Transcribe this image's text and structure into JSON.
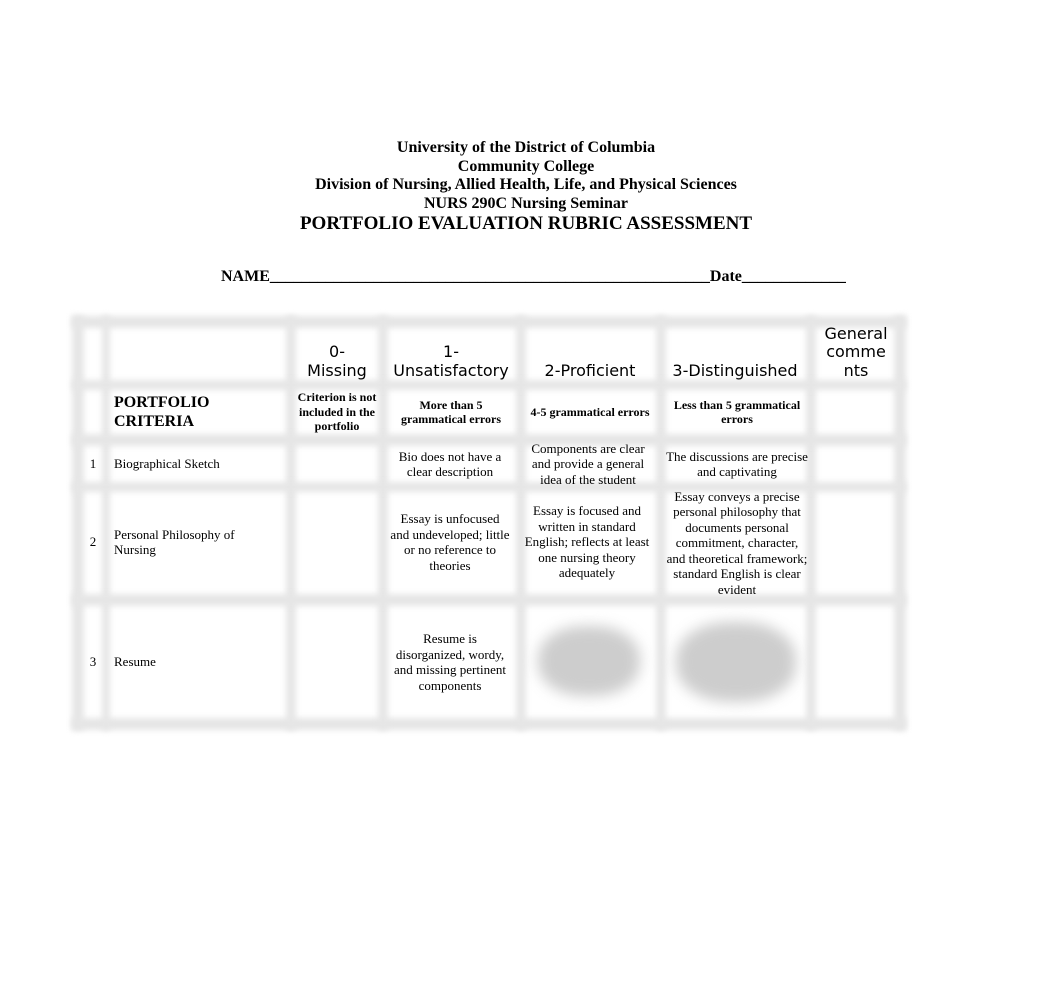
{
  "header": {
    "university": "University of the District of Columbia",
    "college": "Community College",
    "division": "Division of Nursing, Allied Health, Life, and Physical Sciences",
    "course": "NURS 290C Nursing Seminar",
    "title": "PORTFOLIO EVALUATION RUBRIC ASSESSMENT"
  },
  "form": {
    "name_label": "NAME",
    "name_blank": "_______________________________________________________",
    "date_label": "Date",
    "date_blank": "_____________"
  },
  "rubric": {
    "columns": [
      {
        "label": "",
        "sub": ""
      },
      {
        "label": "0-\nMissing",
        "sub": "Criterion is not included in the  portfolio"
      },
      {
        "label": "1-\nUnsatisfactory",
        "sub": "More than 5 grammatical errors"
      },
      {
        "label": "2-Proficient",
        "sub": "4-5 grammatical errors"
      },
      {
        "label": "3-Distinguished",
        "sub": "Less than 5 grammatical errors"
      },
      {
        "label": "General comme nts",
        "sub": ""
      }
    ],
    "criteria_heading": "PORTFOLIO CRITERIA",
    "rows": [
      {
        "num": "1",
        "criterion": "Biographical Sketch",
        "missing": "",
        "unsatisfactory": "Bio does not have a clear description",
        "proficient": "Components are clear and provide a general idea of the student",
        "distinguished": "The discussions are precise and captivating",
        "comments": ""
      },
      {
        "num": "2",
        "criterion": "Personal Philosophy of Nursing",
        "missing": "",
        "unsatisfactory": "Essay is unfocused and undeveloped; little or no reference to theories",
        "proficient": "Essay is focused and written in standard English; reflects at least one nursing theory adequately",
        "distinguished": "Essay conveys a precise personal philosophy that documents personal commitment, character, and theoretical framework; standard English is clear evident",
        "comments": ""
      },
      {
        "num": "3",
        "criterion": "Resume",
        "missing": "",
        "unsatisfactory": "Resume is disorganized, wordy, and missing pertinent components",
        "proficient": "[blurred]",
        "distinguished": "[blurred]",
        "comments": ""
      }
    ]
  }
}
